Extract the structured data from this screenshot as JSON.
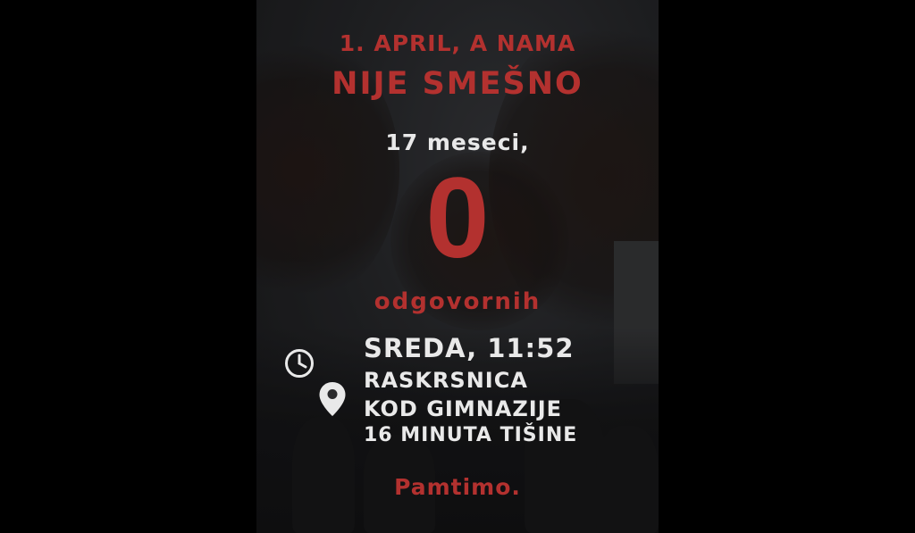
{
  "colors": {
    "accent": "#b3312f",
    "white": "#e9e9e9",
    "background": "#000000"
  },
  "poster": {
    "headline_line1": "1. APRIL, A NAMA",
    "headline_line2": "NIJE SMEŠNO",
    "months_text": "17 meseci,",
    "big_number": "0",
    "responsible_text": "odgovornih",
    "day_time": "SREDA, 11:52",
    "location_line1": "RASKRSNICA",
    "location_line2": "KOD GIMNAZIJE",
    "silence_text": "16 MINUTA TIŠINE",
    "closing_text": "Pamtimo.",
    "icons": {
      "time": "clock-icon",
      "location": "location-pin-icon"
    }
  }
}
